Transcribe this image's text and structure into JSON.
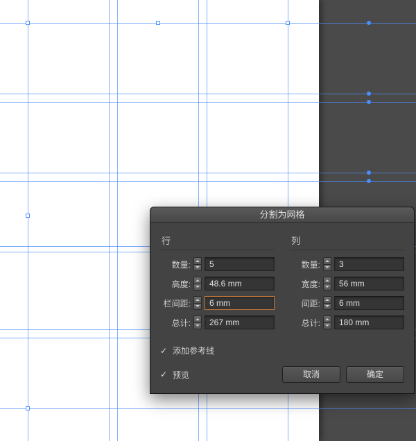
{
  "dialog": {
    "title": "分割为网格",
    "rows_section": {
      "label": "行",
      "fields": {
        "count_label": "数量:",
        "count_value": "5",
        "height_label": "高度:",
        "height_value": "48.6 mm",
        "gutter_label": "栏间距:",
        "gutter_value": "6 mm",
        "total_label": "总计:",
        "total_value": "267 mm"
      }
    },
    "cols_section": {
      "label": "列",
      "fields": {
        "count_label": "数量:",
        "count_value": "3",
        "width_label": "宽度:",
        "width_value": "56 mm",
        "gutter_label": "间距:",
        "gutter_value": "6 mm",
        "total_label": "总计:",
        "total_value": "180 mm"
      }
    },
    "add_guides_label": "添加参考线",
    "preview_label": "预览",
    "cancel_label": "取消",
    "ok_label": "确定"
  }
}
